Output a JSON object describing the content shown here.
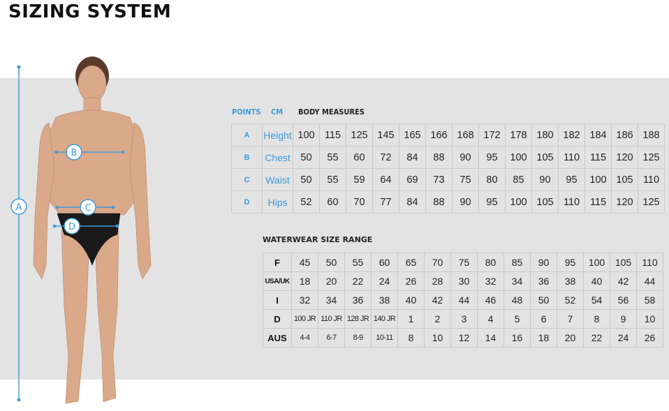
{
  "title": "SIZING SYSTEM",
  "markers": {
    "a": "A",
    "b": "B",
    "c": "C",
    "d": "D"
  },
  "body_measures": {
    "headers": {
      "points": "POINTS",
      "cm": "CM",
      "title": "BODY MEASURES"
    },
    "rows": [
      {
        "point": "A",
        "name": "Height",
        "values": [
          "100",
          "115",
          "125",
          "145",
          "165",
          "166",
          "168",
          "172",
          "178",
          "180",
          "182",
          "184",
          "186",
          "188"
        ]
      },
      {
        "point": "B",
        "name": "Chest",
        "values": [
          "50",
          "55",
          "60",
          "72",
          "84",
          "88",
          "90",
          "95",
          "100",
          "105",
          "110",
          "115",
          "120",
          "125"
        ]
      },
      {
        "point": "C",
        "name": "Waist",
        "values": [
          "50",
          "55",
          "59",
          "64",
          "69",
          "73",
          "75",
          "80",
          "85",
          "90",
          "95",
          "100",
          "105",
          "110"
        ]
      },
      {
        "point": "D",
        "name": "Hips",
        "values": [
          "52",
          "60",
          "70",
          "77",
          "84",
          "88",
          "90",
          "95",
          "100",
          "105",
          "110",
          "115",
          "120",
          "125"
        ]
      }
    ]
  },
  "size_range": {
    "title": "WATERWEAR SIZE RANGE",
    "rows": [
      {
        "label": "F",
        "values": [
          "45",
          "50",
          "55",
          "60",
          "65",
          "70",
          "75",
          "80",
          "85",
          "90",
          "95",
          "100",
          "105",
          "110"
        ]
      },
      {
        "label": "USA/UK",
        "values": [
          "18",
          "20",
          "22",
          "24",
          "26",
          "28",
          "30",
          "32",
          "34",
          "36",
          "38",
          "40",
          "42",
          "44"
        ]
      },
      {
        "label": "I",
        "values": [
          "32",
          "34",
          "36",
          "38",
          "40",
          "42",
          "44",
          "46",
          "48",
          "50",
          "52",
          "54",
          "56",
          "58"
        ]
      },
      {
        "label": "D",
        "values": [
          "100 JR",
          "110 JR",
          "128 JR",
          "140 JR",
          "1",
          "2",
          "3",
          "4",
          "5",
          "6",
          "7",
          "8",
          "9",
          "10"
        ]
      },
      {
        "label": "AUS",
        "values": [
          "4-4",
          "6-7",
          "8-9",
          "10-11",
          "8",
          "10",
          "12",
          "14",
          "16",
          "18",
          "20",
          "22",
          "24",
          "26"
        ]
      }
    ]
  },
  "colors": {
    "accent": "#3f9ad9",
    "band": "#e3e3e3",
    "swimwear": "#1a1a1a",
    "skin": "#d9a98a"
  }
}
